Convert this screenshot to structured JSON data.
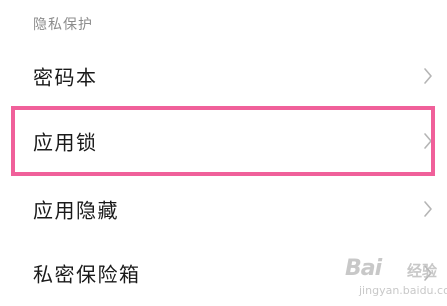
{
  "section": {
    "title": "隐私保护"
  },
  "items": [
    {
      "label": "密码本"
    },
    {
      "label": "应用锁"
    },
    {
      "label": "应用隐藏"
    },
    {
      "label": "私密保险箱"
    }
  ],
  "highlight_color": "#f0609a",
  "chevron_icon": "chevron-right-icon",
  "watermark": {
    "brand": "Bai",
    "cn": "经验",
    "url": "jingyan.baidu.com"
  }
}
